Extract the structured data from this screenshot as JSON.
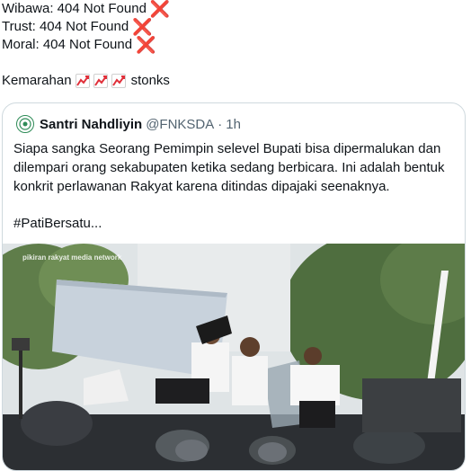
{
  "tweet": {
    "lines": [
      {
        "text": "Wibawa: 404 Not Found",
        "mark": "❌"
      },
      {
        "text": "Trust: 404 Not Found",
        "mark": "❌"
      },
      {
        "text": "Moral: 404 Not Found",
        "mark": "❌"
      }
    ],
    "kemarahan": "Kemarahan",
    "stonks": "stonks",
    "trend_icon": "chart-increasing-icon"
  },
  "quote": {
    "author_name": "Santri Nahdliyin",
    "handle": "@FNKSDA",
    "separator": "·",
    "time": "1h",
    "body_text": "Siapa sangka Seorang Pemimpin selevel Bupati bisa dipermalukan dan dilempari orang sekabupaten ketika sedang berbicara. Ini adalah bentuk konkrit perlawanan Rakyat karena ditindas dipajaki seenaknya.",
    "hashtag": "#PatiBersatu...",
    "media_watermark": "pikiran rakyat media network",
    "media_description": "protest photo: people climbing onto a stage under a banner, police with shields"
  },
  "colors": {
    "cross": "#e0303a",
    "border": "#cfd9de",
    "muted": "#536471",
    "text": "#0f1419"
  }
}
